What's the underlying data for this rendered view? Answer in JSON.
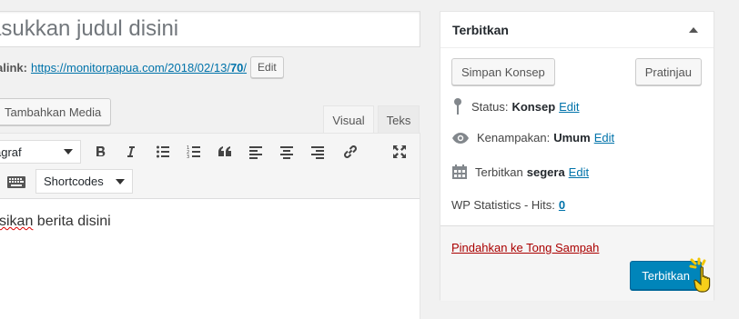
{
  "title": {
    "placeholder": "asukkan judul disini"
  },
  "permalink": {
    "label": "alink:",
    "url_base": "https://monitorpapua.com/2018/02/13/",
    "url_slug": "70",
    "url_end": "/",
    "edit_label": "Edit"
  },
  "media_button": "Tambahkan Media",
  "tabs": {
    "visual": "Visual",
    "text": "Teks"
  },
  "toolbar": {
    "format_value": "agraf",
    "shortcodes_value": "Shortcodes",
    "icons": [
      "bold-icon",
      "italic-icon",
      "bullet-list-icon",
      "numbered-list-icon",
      "blockquote-icon",
      "align-left-icon",
      "align-center-icon",
      "align-right-icon",
      "link-icon",
      "fullscreen-icon",
      "keyboard-icon"
    ]
  },
  "content": {
    "word1": "sikan",
    "rest": " berita disini"
  },
  "publish": {
    "heading": "Terbitkan",
    "save_draft": "Simpan Konsep",
    "preview": "Pratinjau",
    "status_label": "Status:",
    "status_value": "Konsep",
    "visibility_label": "Kenampakan:",
    "visibility_value": "Umum",
    "publish_label": "Terbitkan",
    "publish_value": "segera",
    "edit_label": "Edit",
    "stats_label": "WP Statistics - Hits:",
    "stats_value": "0",
    "trash": "Pindahkan ke Tong Sampah",
    "publish_button": "Terbitkan"
  },
  "colors": {
    "primary": "#0085ba",
    "link": "#0073aa",
    "trash": "#a00000",
    "cursor": "#f2c500"
  }
}
